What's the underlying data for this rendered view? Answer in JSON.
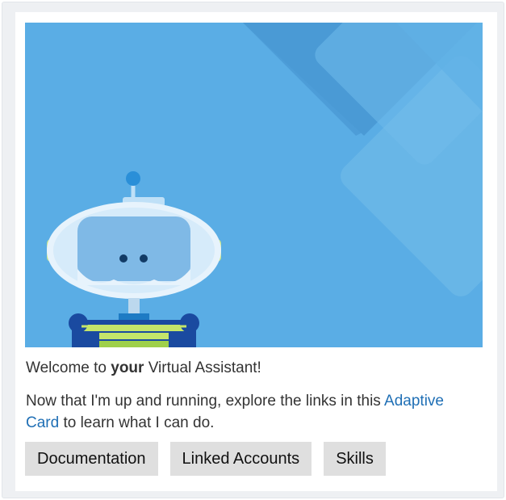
{
  "card": {
    "hero_image": {
      "background_color": "#5aade5",
      "description_icon": "virtual-assistant-robot"
    },
    "title": {
      "prefix": "Welcome to ",
      "emphasis": "your",
      "suffix": " Virtual Assistant!"
    },
    "description": {
      "before_link": "Now that I'm up and running, explore the links in this ",
      "link_text": "Adaptive Card",
      "after_link": " to learn what I can do."
    },
    "actions": [
      {
        "label": "Documentation"
      },
      {
        "label": "Linked Accounts"
      },
      {
        "label": "Skills"
      }
    ]
  },
  "colors": {
    "link": "#1f6fb5",
    "button_bg": "#dfdfdf",
    "frame_bg": "#eef0f3"
  }
}
